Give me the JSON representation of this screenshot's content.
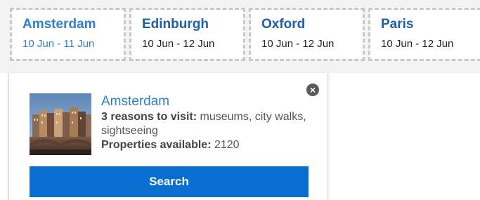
{
  "destinations": [
    {
      "city": "Amsterdam",
      "dates": "10 Jun - 11 Jun",
      "active": true
    },
    {
      "city": "Edinburgh",
      "dates": "10 Jun - 12 Jun",
      "active": false
    },
    {
      "city": "Oxford",
      "dates": "10 Jun - 12 Jun",
      "active": false
    },
    {
      "city": "Paris",
      "dates": "10 Jun - 12 Jun",
      "active": false
    }
  ],
  "popover": {
    "city": "Amsterdam",
    "reasons_label": "3 reasons to visit:",
    "reasons_value": " museums, city walks, sightseeing",
    "properties_label": "Properties available:",
    "properties_value": " 2120",
    "search_label": "Search",
    "close_icon": "close-circle-icon"
  },
  "colors": {
    "link_blue": "#1f5ea8",
    "active_blue": "#2f7fd0",
    "button_blue": "#0b6fd1"
  }
}
